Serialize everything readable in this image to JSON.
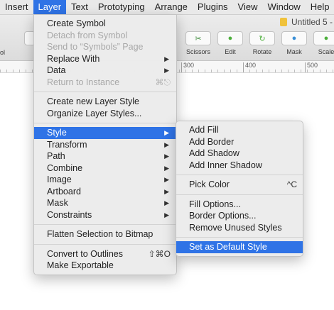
{
  "menubar": {
    "items": [
      {
        "label": "Insert"
      },
      {
        "label": "Layer",
        "active": true
      },
      {
        "label": "Text"
      },
      {
        "label": "Prototyping"
      },
      {
        "label": "Arrange"
      },
      {
        "label": "Plugins"
      },
      {
        "label": "View"
      },
      {
        "label": "Window"
      },
      {
        "label": "Help"
      }
    ]
  },
  "toolbar": {
    "document_title": "Untitled 5 -",
    "left_label": "ol",
    "tools": [
      {
        "label": "Scissors",
        "icon": "scissors-icon"
      },
      {
        "label": "Edit",
        "icon": "edit-icon"
      },
      {
        "label": "Rotate",
        "icon": "rotate-icon"
      },
      {
        "label": "Mask",
        "icon": "mask-icon"
      },
      {
        "label": "Scale",
        "icon": "scale-icon"
      }
    ]
  },
  "ruler": {
    "labels": [
      "300",
      "400",
      "500"
    ]
  },
  "layer_menu": {
    "groups": [
      [
        {
          "label": "Create Symbol"
        },
        {
          "label": "Detach from Symbol",
          "disabled": true
        },
        {
          "label": "Send to “Symbols” Page",
          "disabled": true
        },
        {
          "label": "Replace With",
          "submenu": true
        },
        {
          "label": "Data",
          "submenu": true
        },
        {
          "label": "Return to Instance",
          "disabled": true,
          "shortcut": "⌘⎋"
        }
      ],
      [
        {
          "label": "Create new Layer Style"
        },
        {
          "label": "Organize Layer Styles..."
        }
      ],
      [
        {
          "label": "Style",
          "submenu": true,
          "highlighted": true
        },
        {
          "label": "Transform",
          "submenu": true
        },
        {
          "label": "Path",
          "submenu": true
        },
        {
          "label": "Combine",
          "submenu": true
        },
        {
          "label": "Image",
          "submenu": true
        },
        {
          "label": "Artboard",
          "submenu": true
        },
        {
          "label": "Mask",
          "submenu": true
        },
        {
          "label": "Constraints",
          "submenu": true
        }
      ],
      [
        {
          "label": "Flatten Selection to Bitmap"
        }
      ],
      [
        {
          "label": "Convert to Outlines",
          "shortcut": "⇧⌘O"
        },
        {
          "label": "Make Exportable"
        }
      ]
    ]
  },
  "style_menu": {
    "groups": [
      [
        {
          "label": "Add Fill"
        },
        {
          "label": "Add Border"
        },
        {
          "label": "Add Shadow"
        },
        {
          "label": "Add Inner Shadow"
        }
      ],
      [
        {
          "label": "Pick Color",
          "shortcut": "^C"
        }
      ],
      [
        {
          "label": "Fill Options..."
        },
        {
          "label": "Border Options..."
        },
        {
          "label": "Remove Unused Styles"
        }
      ],
      [
        {
          "label": "Set as Default Style",
          "highlighted": true
        }
      ]
    ]
  },
  "colors": {
    "highlight": "#2f73e6",
    "menu_bg": "#ececec",
    "disabled_text": "#a8a8a8"
  }
}
